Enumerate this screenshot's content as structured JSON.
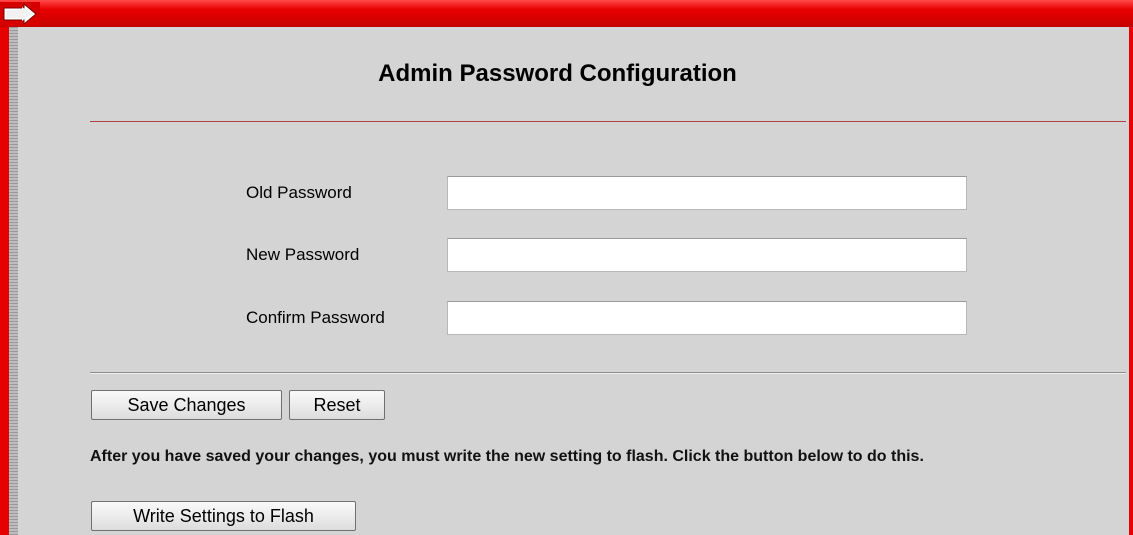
{
  "page": {
    "title": "Admin Password Configuration"
  },
  "form": {
    "fields": [
      {
        "label": "Old Password",
        "value": "",
        "placeholder": ""
      },
      {
        "label": "New Password",
        "value": "",
        "placeholder": ""
      },
      {
        "label": "Confirm Password",
        "value": "",
        "placeholder": ""
      }
    ]
  },
  "actions": {
    "save_label": "Save Changes",
    "reset_label": "Reset",
    "flash_label": "Write Settings to Flash"
  },
  "notice": {
    "text": "After you have saved your changes, you must write the new setting to flash. Click the button below to do this."
  },
  "colors": {
    "frame_red": "#e60000",
    "background": "#d4d4d4",
    "title_rule": "#b04040"
  },
  "icons": {
    "corner": "frame-corner-arrow-icon"
  }
}
